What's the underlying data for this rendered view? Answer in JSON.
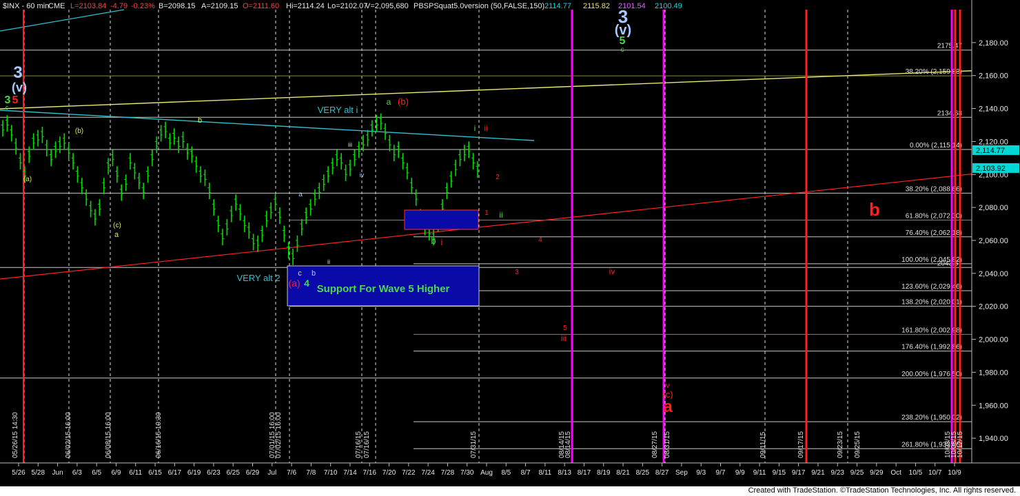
{
  "header": {
    "symbol": "$INX - 60 min",
    "exchange": "CME",
    "last": "L=2103.84",
    "change": "-4.79",
    "pct": "-0.23%",
    "bid": "B=2098.15",
    "ask": "A=2109.15",
    "open": "O=2111.60",
    "high": "Hi=2114.24",
    "low": "Lo=2102.07",
    "volume": "V=2,095,680",
    "indicator": "PBSPSquat5.0version (50,FALSE,150)",
    "ind_values": [
      "2114.77",
      "2115.82",
      "2101.54",
      "2100.49"
    ]
  },
  "footer": {
    "credit": "Created with TradeStation. ©TradeStation Technologies, Inc. All rights reserved."
  },
  "colors": {
    "background": "#000000",
    "bars": "#00dd00",
    "grid": "#cfcfcf",
    "fib_light": "#c8c8c8",
    "fib_olive": "#8a8a3a",
    "red_line": "#ff2020",
    "magenta": "#ff00ff",
    "yellow_line": "#e8e870",
    "cyan_line": "#2fc0d0",
    "support_box": "#0a0aa8",
    "label_blue": "#a8c8ff",
    "label_green": "#4bd84b",
    "label_yellow": "#e6e65a",
    "label_red": "#ff2020",
    "price_tag_cyan": "#00d8d8"
  },
  "chart_data": {
    "type": "bar",
    "title": "",
    "xlabel": "",
    "ylabel": "",
    "ylim": [
      1925,
      2200
    ],
    "price_ticks": [
      1940,
      1960,
      1980,
      2000,
      2020,
      2040,
      2060,
      2080,
      2100,
      2120,
      2140,
      2160,
      2180
    ],
    "price_tick_labels": [
      "1,940.00",
      "1,960.00",
      "1,980.00",
      "2,000.00",
      "2,020.00",
      "2,040.00",
      "2,060.00",
      "2,080.00",
      "2,100.00",
      "2,120.00",
      "2,140.00",
      "2,160.00",
      "2,180.00"
    ],
    "date_labels": [
      "5/26",
      "5/28",
      "Jun",
      "6/3",
      "6/5",
      "6/9",
      "6/11",
      "6/15",
      "6/17",
      "6/19",
      "6/23",
      "6/25",
      "6/29",
      "Jul",
      "7/6",
      "7/8",
      "7/10",
      "7/14",
      "7/16",
      "7/20",
      "7/22",
      "7/24",
      "7/28",
      "7/30",
      "Aug",
      "8/5",
      "8/7",
      "8/11",
      "8/13",
      "8/17",
      "8/19",
      "8/21",
      "8/25",
      "8/27",
      "Sep",
      "9/3",
      "9/7",
      "9/9",
      "9/11",
      "9/15",
      "9/17",
      "9/21",
      "9/23",
      "9/25",
      "9/29",
      "Oct",
      "10/5",
      "10/7",
      "10/9"
    ],
    "vertical_date_labels": [
      "05/26/15 14:30",
      "06/02/15 16:00",
      "06/08/15 16:00",
      "06/16/15 10:30",
      "07/01/15 16:00",
      "07/02/15 16:00",
      "07/16/15",
      "07/16/15",
      "07/31/15",
      "08/14/15",
      "08/14/15",
      "08/27/15",
      "08/31/15",
      "09/11/15",
      "09/17/15",
      "09/23/15",
      "09/25/15",
      "10/08/15",
      "10/08/15",
      "10/12/15"
    ],
    "price_series": [
      2128,
      2131,
      2125,
      2117,
      2108,
      2100,
      2112,
      2120,
      2122,
      2124,
      2116,
      2110,
      2115,
      2118,
      2120,
      2114,
      2108,
      2100,
      2093,
      2086,
      2079,
      2074,
      2080,
      2093,
      2105,
      2110,
      2100,
      2089,
      2095,
      2108,
      2102,
      2096,
      2090,
      2100,
      2110,
      2118,
      2125,
      2127,
      2120,
      2123,
      2118,
      2121,
      2114,
      2112,
      2106,
      2100,
      2098,
      2090,
      2080,
      2070,
      2062,
      2068,
      2076,
      2083,
      2077,
      2070,
      2066,
      2059,
      2058,
      2064,
      2073,
      2078,
      2083,
      2075,
      2064,
      2054,
      2050,
      2058,
      2068,
      2075,
      2080,
      2086,
      2090,
      2095,
      2100,
      2105,
      2110,
      2108,
      2101,
      2104,
      2110,
      2115,
      2119,
      2122,
      2128,
      2131,
      2132,
      2126,
      2119,
      2113,
      2115,
      2108,
      2102,
      2093,
      2086,
      2074,
      2068,
      2065,
      2062,
      2070,
      2080,
      2090,
      2097,
      2104,
      2110,
      2113,
      2115,
      2108,
      2103
    ],
    "fib_levels": [
      {
        "label": "2175.47",
        "value": 2175.47
      },
      {
        "label": "38.20% (2,159.83)",
        "value": 2159.83
      },
      {
        "label": "2134.68",
        "value": 2134.68
      },
      {
        "label": "0.00% (2,115.14)",
        "value": 2115.14
      },
      {
        "label": "38.20% (2,088.66)",
        "value": 2088.66
      },
      {
        "label": "61.80% (2,072.30)",
        "value": 2072.3
      },
      {
        "label": "76.40% (2,062.18)",
        "value": 2062.18
      },
      {
        "label": "100.00% (2,045.82)",
        "value": 2045.82
      },
      {
        "label": "2043.57",
        "value": 2043.57
      },
      {
        "label": "123.60% (2,029.46)",
        "value": 2029.46
      },
      {
        "label": "138.20% (2,020.01)",
        "value": 2020.01
      },
      {
        "label": "161.80% (2,002.98)",
        "value": 2002.98
      },
      {
        "label": "176.40% (1,992.86)",
        "value": 1992.86
      },
      {
        "label": "200.00% (1,976.50)",
        "value": 1976.5
      },
      {
        "label": "238.20% (1,950.02)",
        "value": 1950.02
      },
      {
        "label": "261.80% (1,933.66)",
        "value": 1933.66
      }
    ],
    "price_tags": [
      {
        "label": "2,114.77",
        "value": 2114.77
      },
      {
        "label": "2,103.92",
        "value": 2103.92
      }
    ],
    "annotations": {
      "very_alt_i": "VERY alt i",
      "very_alt_2": "VERY alt 2",
      "support": "Support For Wave 5 Higher",
      "wave_3_left": "3",
      "wave_v_left": "(v)",
      "wave_3g": "3",
      "wave_5r": "5",
      "wave_c_small": "c",
      "wave_a_paren": "(a)",
      "wave_b_paren": "(b)",
      "wave_c_paren_y": "(c)",
      "wave_a_y": "a",
      "wave_b_y": "b",
      "wave_3_top": "3",
      "wave_v_top": "(v)",
      "wave_5_top": "5",
      "wave_c_top": "c",
      "wave_a_green": "a",
      "wave_b_red": "(b)",
      "wave_iii": "iii",
      "wave_iv": "iv",
      "wave_ii_small": "ii",
      "wave_a_blue": "a",
      "wave_c_blue": "c",
      "wave_b_blue": "b",
      "wave_a_red": "(a)",
      "wave_4_green": "4",
      "wave_i_green": "i",
      "wave_ii_red": "ii",
      "wave_2_red": "2",
      "wave_1_red": "1",
      "wave_ii_green": "ii",
      "wave_4_red": "4",
      "wave_3_red": "3",
      "wave_5_red": "5",
      "wave_iii_red": "iii",
      "wave_iv_red": "iv",
      "wave_b_green": "b",
      "wave_i_red": "i",
      "wave_v_red": "v",
      "wave_c_red": "(c)",
      "wave_a_big": "a",
      "wave_b_big": "b"
    }
  }
}
